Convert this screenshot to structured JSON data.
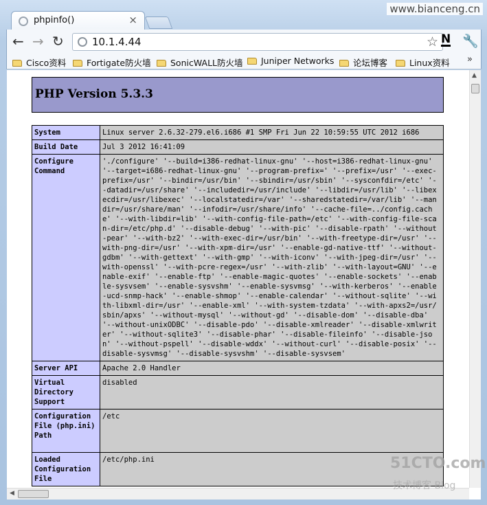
{
  "watermark_top": "www.bianceng.cn",
  "tab": {
    "title": "phpinfo()",
    "close": "×"
  },
  "nav": {
    "back": "←",
    "forward": "→",
    "reload": "↻"
  },
  "omnibox": {
    "url": "10.1.4.44",
    "star": "☆"
  },
  "toolbar": {
    "ext": "N",
    "wrench": "🔧"
  },
  "bookmarks": [
    "Cisco资料",
    "Fortigate防火墙",
    "SonicWALL防火墙",
    "Juniper Networks",
    "论坛博客",
    "Linux资料"
  ],
  "bookmarks_more": "»",
  "php": {
    "version": "PHP Version 5.3.3",
    "rows": [
      {
        "k": "System",
        "v": "Linux server 2.6.32-279.el6.i686 #1 SMP Fri Jun 22 10:59:55 UTC 2012 i686"
      },
      {
        "k": "Build Date",
        "v": "Jul 3 2012 16:41:09"
      },
      {
        "k": "Configure Command",
        "v": "'./configure' '--build=i386-redhat-linux-gnu' '--host=i386-redhat-linux-gnu' '--target=i686-redhat-linux-gnu' '--program-prefix=' '--prefix=/usr' '--exec-prefix=/usr' '--bindir=/usr/bin' '--sbindir=/usr/sbin' '--sysconfdir=/etc' '--datadir=/usr/share' '--includedir=/usr/include' '--libdir=/usr/lib' '--libexecdir=/usr/libexec' '--localstatedir=/var' '--sharedstatedir=/var/lib' '--mandir=/usr/share/man' '--infodir=/usr/share/info' '--cache-file=../config.cache' '--with-libdir=lib' '--with-config-file-path=/etc' '--with-config-file-scan-dir=/etc/php.d' '--disable-debug' '--with-pic' '--disable-rpath' '--without-pear' '--with-bz2' '--with-exec-dir=/usr/bin' '--with-freetype-dir=/usr' '--with-png-dir=/usr' '--with-xpm-dir=/usr' '--enable-gd-native-ttf' '--without-gdbm' '--with-gettext' '--with-gmp' '--with-iconv' '--with-jpeg-dir=/usr' '--with-openssl' '--with-pcre-regex=/usr' '--with-zlib' '--with-layout=GNU' '--enable-exif' '--enable-ftp' '--enable-magic-quotes' '--enable-sockets' '--enable-sysvsem' '--enable-sysvshm' '--enable-sysvmsg' '--with-kerberos' '--enable-ucd-snmp-hack' '--enable-shmop' '--enable-calendar' '--without-sqlite' '--with-libxml-dir=/usr' '--enable-xml' '--with-system-tzdata' '--with-apxs2=/usr/sbin/apxs' '--without-mysql' '--without-gd' '--disable-dom' '--disable-dba' '--without-unixODBC' '--disable-pdo' '--disable-xmlreader' '--disable-xmlwriter' '--without-sqlite3' '--disable-phar' '--disable-fileinfo' '--disable-json' '--without-pspell' '--disable-wddx' '--without-curl' '--disable-posix' '--disable-sysvmsg' '--disable-sysvshm' '--disable-sysvsem'"
      },
      {
        "k": "Server API",
        "v": "Apache 2.0 Handler"
      },
      {
        "k": "Virtual Directory Support",
        "v": "disabled"
      },
      {
        "k": "Configuration File (php.ini) Path",
        "v": "/etc"
      },
      {
        "k": "Loaded Configuration File",
        "v": "/etc/php.ini"
      }
    ]
  },
  "watermark_bottom": {
    "brand": "51CTO.com",
    "sub": "技术博客 Blog"
  },
  "colors": {
    "php_header": "#9999cc",
    "key_cell": "#ccccff",
    "value_cell": "#cccccc"
  }
}
